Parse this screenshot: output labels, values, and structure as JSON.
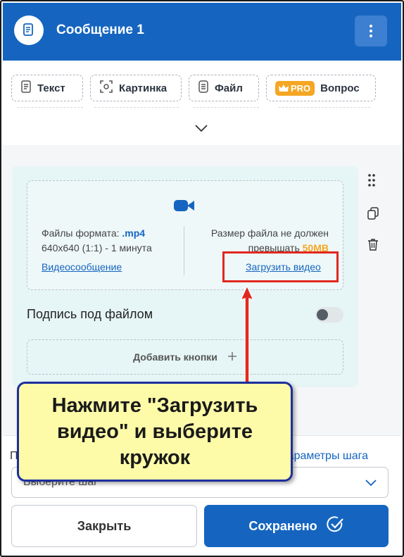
{
  "header": {
    "title": "Сообщение 1",
    "avatar_icon": "document-icon",
    "menu_icon": "kebab-menu-icon",
    "color": "#1565c0"
  },
  "toolbar": {
    "buttons": [
      {
        "label": "Текст",
        "icon": "text-doc-icon"
      },
      {
        "label": "Картинка",
        "icon": "image-scan-icon"
      },
      {
        "label": "Файл",
        "icon": "file-icon"
      },
      {
        "label": "Вопрос",
        "icon": "question-icon",
        "badge": "PRO"
      }
    ],
    "expand_icon": "chevron-down-icon"
  },
  "upload": {
    "icon": "video-camera-icon",
    "format_prefix": "Файлы формата: ",
    "format_value": ".mp4",
    "format_dims": "640x640 (1:1) - 1 минута",
    "size_line1": "Размер файла не должен",
    "size_prefix": "превышать ",
    "size_value": "50MB",
    "video_message_link": "Видеосообщение",
    "upload_video_link": "Загрузить видео"
  },
  "caption": {
    "label": "Подпись под файлом",
    "toggle_on": false
  },
  "add_buttons": {
    "label": "Добавить кнопки",
    "icon": "plus-icon"
  },
  "side_tools": [
    "drag-handle-icon",
    "copy-icon",
    "trash-icon"
  ],
  "footer": {
    "label_left": "П",
    "link": "параметры шага",
    "select_placeholder": "Выберите шаг",
    "close_label": "Закрыть",
    "save_label": "Сохранено",
    "save_icon": "check-circle-icon"
  },
  "callout": {
    "text": "Нажмите \"Загрузить видео\" и выберите кружок",
    "background": "#fdfba8",
    "border": "#1d2f9c"
  },
  "colors": {
    "accent": "#1565c0",
    "pro": "#f5a623",
    "highlight_red": "#e0281f"
  }
}
